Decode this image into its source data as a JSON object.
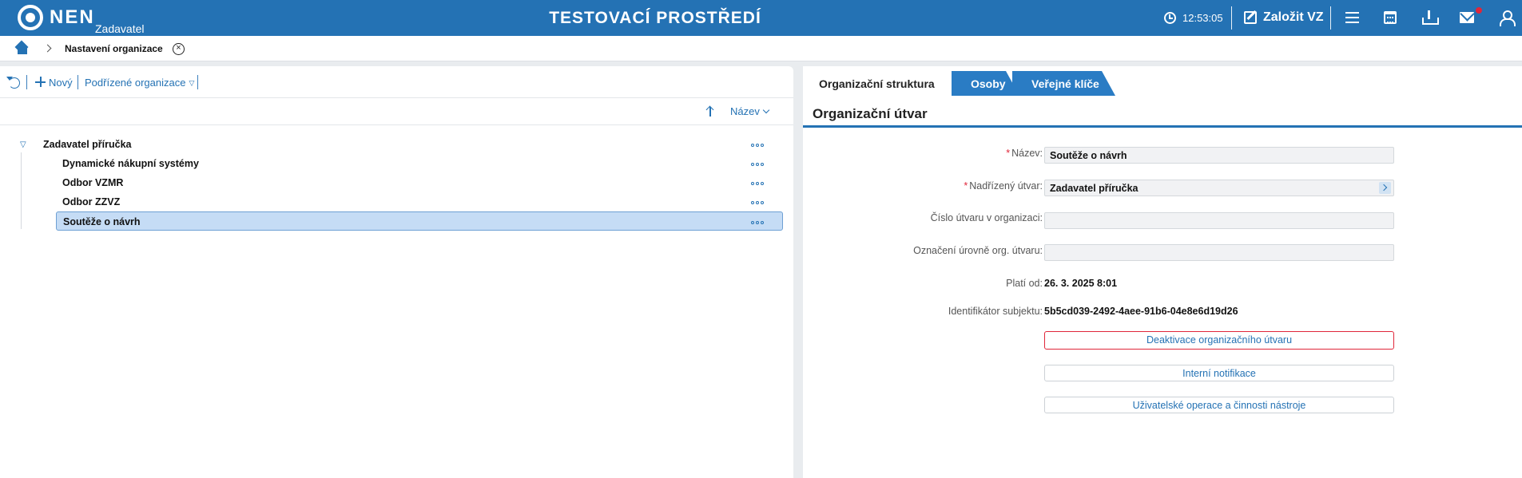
{
  "header": {
    "brand": "NEN",
    "brand_sub": "Zadavatel",
    "environment_title": "TESTOVACÍ PROSTŘEDÍ",
    "clock_time": "12:53:05",
    "create_label": "Založit VZ",
    "accent_color": "#2472b4",
    "notification_color": "#e0263a"
  },
  "breadcrumb": {
    "current": "Nastavení organizace"
  },
  "left_toolbar": {
    "new_label": "Nový",
    "sub_orgs_label": "Podřízené organizace"
  },
  "sort": {
    "label": "Název"
  },
  "tree": {
    "root": "Zadavatel příručka",
    "children": [
      "Dynamické nákupní systémy",
      "Odbor VZMR",
      "Odbor ZZVZ",
      "Soutěže o návrh"
    ],
    "selected_index": 3
  },
  "tabs": [
    "Organizační struktura",
    "Osoby",
    "Veřejné klíče"
  ],
  "section_title": "Organizační útvar",
  "form": {
    "name_label": "Název:",
    "name_value": "Soutěže o návrh",
    "parent_label": "Nadřízený útvar:",
    "parent_value": "Zadavatel příručka",
    "number_label": "Číslo útvaru v organizaci:",
    "number_value": "",
    "level_label": "Označení úrovně org. útvaru:",
    "level_value": "",
    "valid_from_label": "Platí od:",
    "valid_from_value": "26. 3. 2025 8:01",
    "subject_id_label": "Identifikátor subjektu:",
    "subject_id_value": "5b5cd039-2492-4aee-91b6-04e8e6d19d26"
  },
  "actions": {
    "deactivate": "Deaktivace organizačního útvaru",
    "internal_notifications": "Interní notifikace",
    "user_operations": "Uživatelské operace a činnosti nástroje"
  }
}
